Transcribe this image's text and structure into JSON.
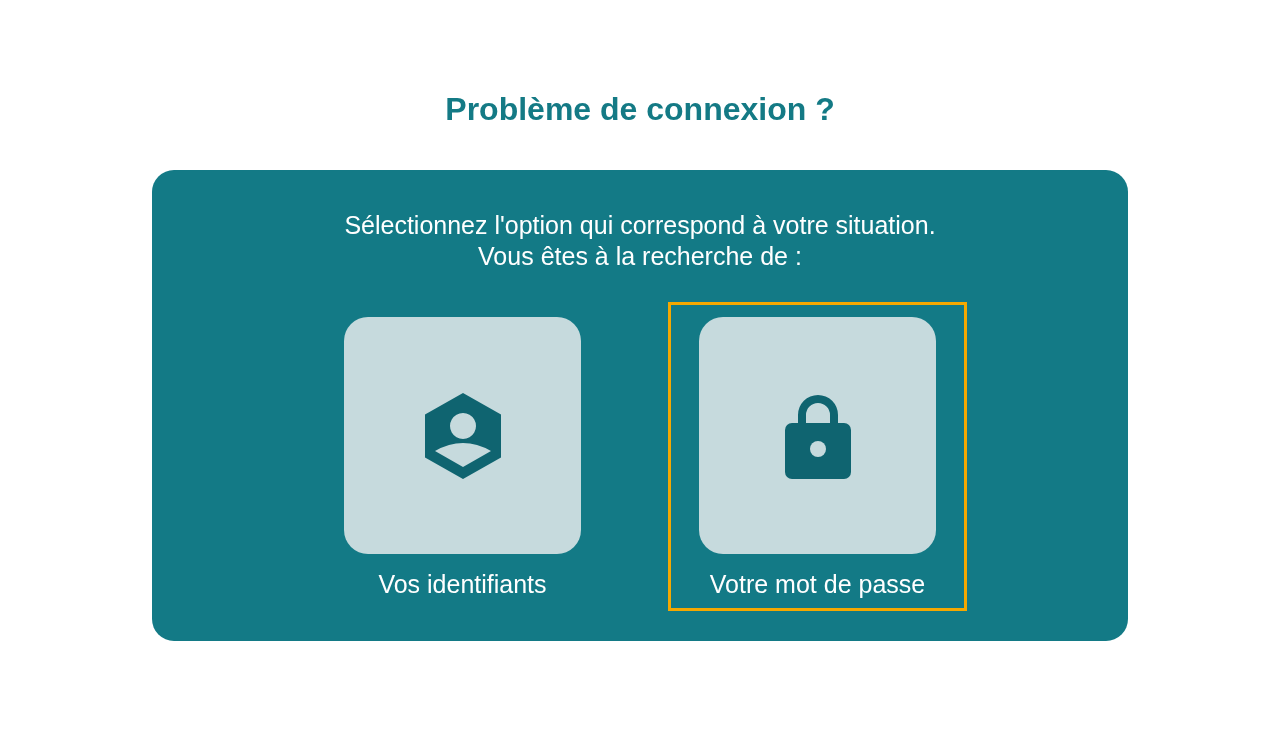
{
  "title": "Problème de connexion ?",
  "panel": {
    "intro": [
      "Sélectionnez l'option qui correspond à votre situation.",
      "Vous êtes à la recherche de :"
    ],
    "options": [
      {
        "label": "Vos identifiants",
        "kind": "identity",
        "selected": false
      },
      {
        "label": "Votre mot de passe",
        "kind": "lock",
        "selected": true
      }
    ]
  }
}
